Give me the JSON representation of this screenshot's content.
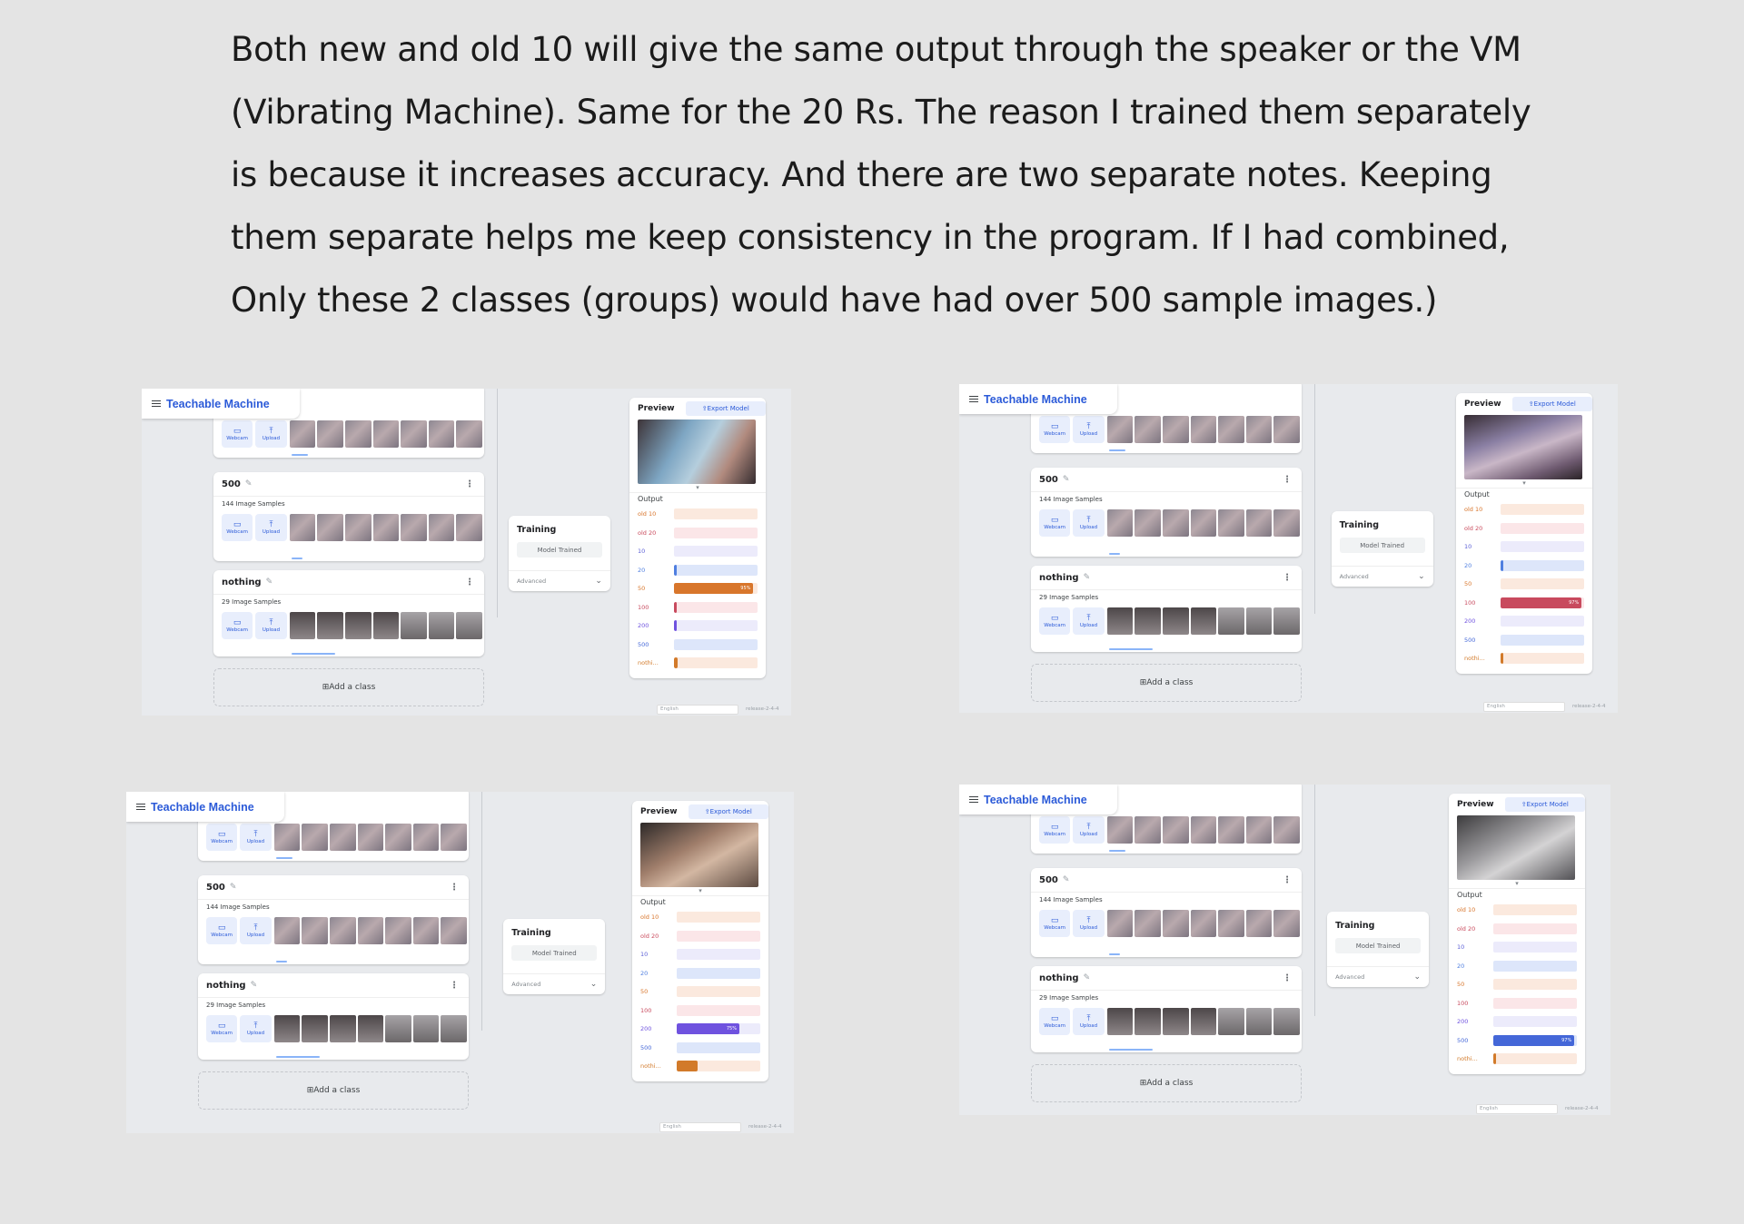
{
  "paragraph": "Both new and old 10 will give the same output through the speaker or the VM (Vibrating Machine). Same for the 20 Rs. The reason I trained them separately is because it increases accuracy. And there are two separate notes. Keeping them separate helps me keep consistency in the program. If I had combined, Only these 2 classes (groups) would have had over 500 sample images.)",
  "app": {
    "title": "Teachable Machine",
    "webcam_label": "Webcam",
    "upload_label": "Upload",
    "add_class_label": "Add a class"
  },
  "classes": [
    {
      "name": "500",
      "samples": "144 Image Samples"
    },
    {
      "name": "nothing",
      "samples": "29 Image Samples"
    }
  ],
  "training": {
    "title": "Training",
    "button": "Model Trained",
    "advanced": "Advanced"
  },
  "preview": {
    "title": "Preview",
    "export": "Export Model",
    "output_title": "Output",
    "labels": [
      "old 10",
      "old 20",
      "10",
      "20",
      "50",
      "100",
      "200",
      "500",
      "nothi..."
    ]
  },
  "footer": {
    "language": "English",
    "release": "release-2-4-4"
  },
  "screenshots": [
    {
      "active_class": "50",
      "active_value": "95%",
      "active_fraction": 0.95,
      "minor": {
        "20": 0.03,
        "100": 0.02,
        "200": 0.03,
        "nothi...": 0.04
      }
    },
    {
      "active_class": "100",
      "active_value": "97%",
      "active_fraction": 0.97,
      "minor": {
        "20": 0.02,
        "nothi...": 0.02
      }
    },
    {
      "active_class": "200",
      "active_value": "75%",
      "active_fraction": 0.75,
      "minor": {
        "nothi...": 0.25
      },
      "minor_label": {
        "nothi...": "25%"
      }
    },
    {
      "active_class": "500",
      "active_value": "97%",
      "active_fraction": 0.97,
      "minor": {
        "nothi...": 0.02
      }
    }
  ],
  "colors": {
    "old 10": "#d8742a",
    "old 20": "#c94a5c",
    "10": "#5b5fd6",
    "20": "#4f7fe0",
    "50": "#d8762b",
    "100": "#c84a5e",
    "200": "#6f52df",
    "500": "#4467d8",
    "nothi...": "#d27a2a"
  },
  "track_colors": {
    "old 10": "#fbe9de",
    "old 20": "#fbe6e8",
    "10": "#ecebfb",
    "20": "#dde6fa",
    "50": "#fbe9de",
    "100": "#fbe6e8",
    "200": "#ecebfb",
    "500": "#dde6fa",
    "nothi...": "#fbe9de"
  }
}
